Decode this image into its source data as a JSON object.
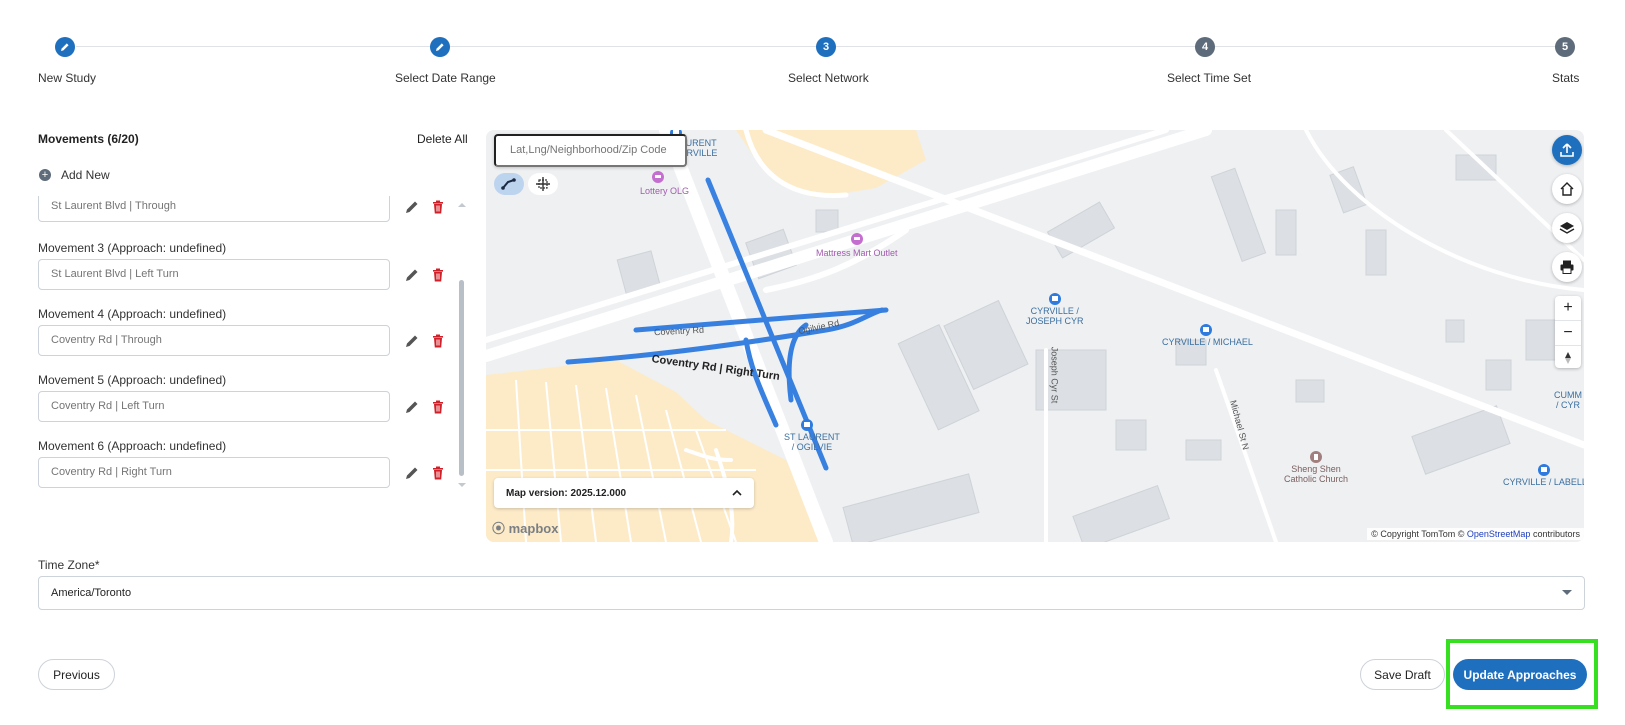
{
  "stepper": {
    "steps": [
      {
        "label": "New Study",
        "marker": "pencil-icon",
        "state": "done"
      },
      {
        "label": "Select Date Range",
        "marker": "pencil-icon",
        "state": "done"
      },
      {
        "label": "Select Network",
        "marker": "3",
        "state": "active"
      },
      {
        "label": "Select Time Set",
        "marker": "4",
        "state": "todo"
      },
      {
        "label": "Stats",
        "marker": "5",
        "state": "todo"
      }
    ]
  },
  "movements": {
    "header": "Movements (6/20)",
    "delete_all": "Delete All",
    "add_new": "Add New",
    "items": [
      {
        "label": "",
        "placeholder": "St Laurent Blvd | Through"
      },
      {
        "label": "Movement 3 (Approach: undefined)",
        "placeholder": "St Laurent Blvd | Left Turn"
      },
      {
        "label": "Movement 4 (Approach: undefined)",
        "placeholder": "Coventry Rd | Through"
      },
      {
        "label": "Movement 5 (Approach: undefined)",
        "placeholder": "Coventry Rd | Left Turn"
      },
      {
        "label": "Movement 6 (Approach: undefined)",
        "placeholder": "Coventry Rd | Right Turn"
      }
    ]
  },
  "map": {
    "search_placeholder": "Lat,Lng/Neighborhood/Zip Code",
    "version": "Map version: 2025.12.000",
    "logo": "mapbox",
    "attribution_prefix": "© Copyright TomTom ©",
    "attribution_link": "OpenStreetMap",
    "attribution_suffix": "contributors",
    "pois": {
      "laurent_cyrville": "LAURENT\nCYRVILLE",
      "lottery": "Lottery OLG",
      "mattress": "Mattress Mart Outlet",
      "cyrville_joseph": "CYRVILLE /\nJOSEPH CYR",
      "cyrville_michael": "CYRVILLE / MICHAEL",
      "st_laurent_ogilvie": "ST LAURENT\n/ OGILVIE",
      "sheng_shen": "Sheng Shen\nCatholic Church",
      "cyrville_labelle": "CYRVILLE / LABELL",
      "cumm": "CUMM\n/ CYR"
    },
    "road_labels": {
      "coventry_rd": "Coventry Rd",
      "coventry_right": "Coventry Rd | Right Turn",
      "ogilvie": "Ogilvie Rd",
      "joseph_cyr": "Joseph Cyr St",
      "michael_st": "Michael St N"
    },
    "colors": {
      "route": "#2e7be0",
      "residential": "#fdebc8",
      "accent": "#1f6fbf"
    }
  },
  "timezone": {
    "label": "Time Zone*",
    "value": "America/Toronto"
  },
  "footer": {
    "previous": "Previous",
    "save_draft": "Save Draft",
    "update_approaches": "Update Approaches"
  }
}
